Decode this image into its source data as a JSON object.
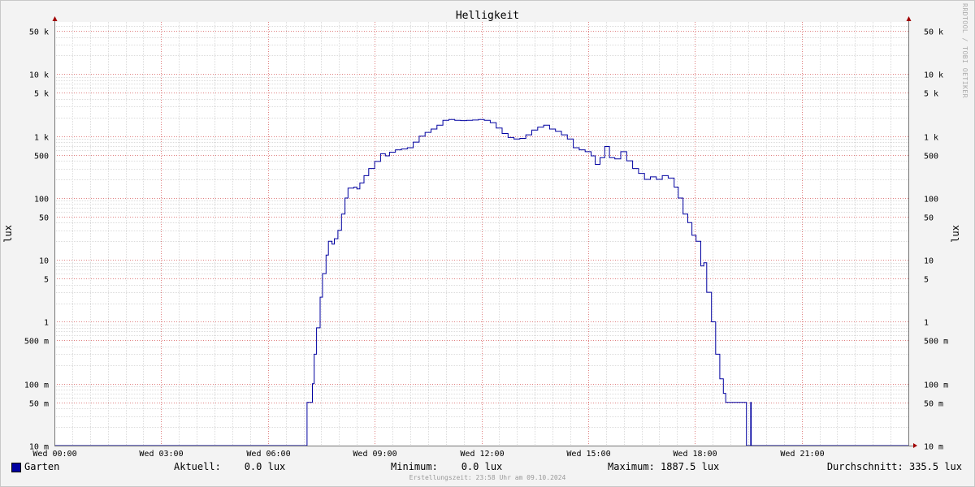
{
  "chart_data": {
    "type": "line",
    "title": "Helligkeit",
    "ylabel": "lux",
    "ylabel_right": "lux",
    "y_scale": "log",
    "ylim": [
      0.01,
      70000
    ],
    "xlim": [
      "00:00",
      "24:00"
    ],
    "x_ticks": [
      {
        "time": "00:00",
        "label": "Wed 00:00"
      },
      {
        "time": "03:00",
        "label": "Wed 03:00"
      },
      {
        "time": "06:00",
        "label": "Wed 06:00"
      },
      {
        "time": "09:00",
        "label": "Wed 09:00"
      },
      {
        "time": "12:00",
        "label": "Wed 12:00"
      },
      {
        "time": "15:00",
        "label": "Wed 15:00"
      },
      {
        "time": "18:00",
        "label": "Wed 18:00"
      },
      {
        "time": "21:00",
        "label": "Wed 21:00"
      }
    ],
    "y_ticks": [
      {
        "value": 0.01,
        "label": "10 m"
      },
      {
        "value": 0.05,
        "label": "50 m"
      },
      {
        "value": 0.1,
        "label": "100 m"
      },
      {
        "value": 0.5,
        "label": "500 m"
      },
      {
        "value": 1,
        "label": "1"
      },
      {
        "value": 5,
        "label": "5"
      },
      {
        "value": 10,
        "label": "10"
      },
      {
        "value": 50,
        "label": "50"
      },
      {
        "value": 100,
        "label": "100"
      },
      {
        "value": 500,
        "label": "500"
      },
      {
        "value": 1000,
        "label": "1 k"
      },
      {
        "value": 5000,
        "label": "5 k"
      },
      {
        "value": 10000,
        "label": "10 k"
      },
      {
        "value": 50000,
        "label": "50 k"
      }
    ],
    "grid": true,
    "series": [
      {
        "name": "Garten",
        "color": "#0000a0",
        "points": [
          [
            "00:00",
            0.01
          ],
          [
            "07:05",
            0.01
          ],
          [
            "07:06",
            0.05
          ],
          [
            "07:13",
            0.05
          ],
          [
            "07:15",
            0.1
          ],
          [
            "07:18",
            0.3
          ],
          [
            "07:22",
            0.8
          ],
          [
            "07:28",
            2.5
          ],
          [
            "07:32",
            6
          ],
          [
            "07:38",
            12
          ],
          [
            "07:42",
            20
          ],
          [
            "07:48",
            18
          ],
          [
            "07:52",
            22
          ],
          [
            "07:58",
            30
          ],
          [
            "08:04",
            55
          ],
          [
            "08:10",
            100
          ],
          [
            "08:15",
            145
          ],
          [
            "08:25",
            150
          ],
          [
            "08:30",
            140
          ],
          [
            "08:35",
            175
          ],
          [
            "08:42",
            230
          ],
          [
            "08:50",
            300
          ],
          [
            "09:00",
            390
          ],
          [
            "09:10",
            520
          ],
          [
            "09:18",
            480
          ],
          [
            "09:25",
            550
          ],
          [
            "09:35",
            600
          ],
          [
            "09:45",
            620
          ],
          [
            "09:55",
            650
          ],
          [
            "10:05",
            800
          ],
          [
            "10:15",
            1000
          ],
          [
            "10:25",
            1150
          ],
          [
            "10:35",
            1300
          ],
          [
            "10:45",
            1500
          ],
          [
            "10:55",
            1800
          ],
          [
            "11:05",
            1850
          ],
          [
            "11:15",
            1800
          ],
          [
            "11:25",
            1780
          ],
          [
            "11:35",
            1800
          ],
          [
            "11:45",
            1820
          ],
          [
            "11:55",
            1850
          ],
          [
            "12:05",
            1800
          ],
          [
            "12:15",
            1650
          ],
          [
            "12:25",
            1350
          ],
          [
            "12:35",
            1100
          ],
          [
            "12:45",
            950
          ],
          [
            "12:55",
            900
          ],
          [
            "13:05",
            920
          ],
          [
            "13:15",
            1050
          ],
          [
            "13:25",
            1250
          ],
          [
            "13:35",
            1400
          ],
          [
            "13:45",
            1500
          ],
          [
            "13:55",
            1300
          ],
          [
            "14:05",
            1200
          ],
          [
            "14:15",
            1050
          ],
          [
            "14:25",
            900
          ],
          [
            "14:35",
            650
          ],
          [
            "14:45",
            600
          ],
          [
            "14:55",
            560
          ],
          [
            "15:05",
            480
          ],
          [
            "15:12",
            350
          ],
          [
            "15:20",
            450
          ],
          [
            "15:28",
            680
          ],
          [
            "15:36",
            450
          ],
          [
            "15:45",
            430
          ],
          [
            "15:55",
            560
          ],
          [
            "16:05",
            400
          ],
          [
            "16:15",
            300
          ],
          [
            "16:25",
            250
          ],
          [
            "16:35",
            200
          ],
          [
            "16:45",
            220
          ],
          [
            "16:55",
            200
          ],
          [
            "17:05",
            230
          ],
          [
            "17:15",
            210
          ],
          [
            "17:25",
            150
          ],
          [
            "17:32",
            100
          ],
          [
            "17:40",
            55
          ],
          [
            "17:48",
            40
          ],
          [
            "17:55",
            25
          ],
          [
            "18:02",
            20
          ],
          [
            "18:10",
            8
          ],
          [
            "18:15",
            9
          ],
          [
            "18:20",
            3
          ],
          [
            "18:28",
            1
          ],
          [
            "18:35",
            0.3
          ],
          [
            "18:42",
            0.12
          ],
          [
            "18:48",
            0.07
          ],
          [
            "18:52",
            0.05
          ],
          [
            "19:25",
            0.05
          ],
          [
            "19:27",
            0.01
          ],
          [
            "19:33",
            0.01
          ],
          [
            "19:34",
            0.05
          ],
          [
            "19:35",
            0.01
          ],
          [
            "24:00",
            0.01
          ]
        ]
      }
    ],
    "legend": {
      "name": "Garten",
      "color": "#0000a0",
      "current": "Aktuell:    0.0 lux",
      "minimum": "Minimum:    0.0 lux",
      "maximum": "Maximum: 1887.5 lux",
      "average": "Durchschnitt: 335.5 lux"
    }
  },
  "footer": "Erstellungszeit: 23:58 Uhr am 09.10.2024",
  "watermark": "RRDTOOL / TOBI OETIKER"
}
